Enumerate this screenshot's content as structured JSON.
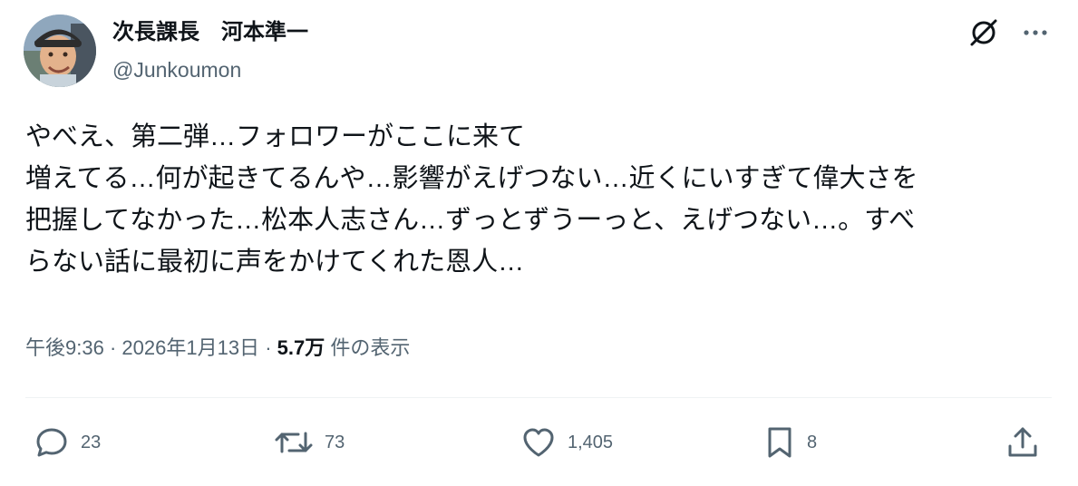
{
  "author": {
    "display_name": "次長課長　河本準一",
    "handle": "@Junkoumon"
  },
  "icons": {
    "grok": "grok-icon",
    "more": "more-dots-icon",
    "reply": "reply-bubble-icon",
    "retweet": "retweet-icon",
    "like": "heart-icon",
    "bookmark": "bookmark-icon",
    "share": "share-upload-icon"
  },
  "tweet": {
    "lines": [
      "やべえ、第二弾…フォロワーがここに来て",
      "増えてる…何が起きてるんや…影響がえげつない…近くにいすぎて偉大さを",
      "把握してなかった…松本人志さん…ずっとずうーっと、えげつない…。すべ",
      "らない話に最初に声をかけてくれた恩人…"
    ]
  },
  "meta": {
    "time": "午後9:36",
    "separator": "·",
    "date": "2026年1月13日",
    "views_count": "5.7万",
    "views_label": "件の表示"
  },
  "actions": {
    "replies": "23",
    "retweets": "73",
    "likes": "1,405",
    "bookmarks": "8"
  },
  "colors": {
    "text": "#0f1419",
    "secondary": "#536471",
    "divider": "#eff3f4"
  }
}
